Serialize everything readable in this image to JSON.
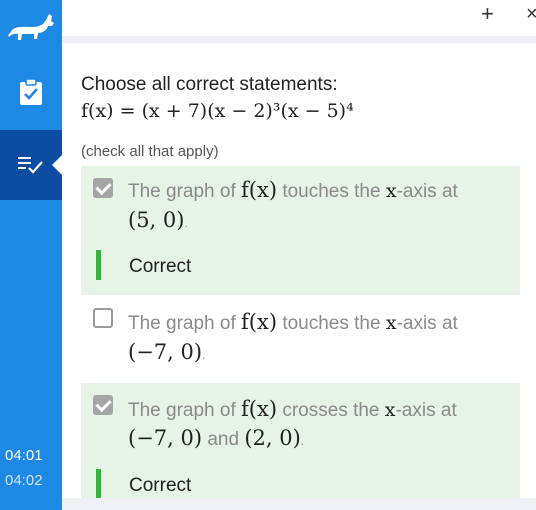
{
  "sidebar": {
    "logo_icon": "dog-logo-icon",
    "task_icon": "clipboard-check-icon",
    "list_icon": "list-check-icon",
    "timestamps": [
      "04:01",
      "04:02"
    ]
  },
  "topbar": {
    "plus_label": "+",
    "close_label": "×"
  },
  "question": {
    "prompt": "Choose all correct statements:",
    "function": "f(x) = (x + 7)(x − 2)³(x − 5)⁴",
    "hint": "(check all that apply)"
  },
  "choices": [
    {
      "checked": true,
      "text_a": "The graph of ",
      "fx": "f(x)",
      "text_b": " touches the ",
      "xvar": "x",
      "text_c": "-axis at",
      "point1": "(5, 0)",
      "dot": ".",
      "feedback": "Correct"
    },
    {
      "checked": false,
      "text_a": "The graph of ",
      "fx": "f(x)",
      "text_b": " touches the ",
      "xvar": "x",
      "text_c": "-axis at",
      "point1": "(−7, 0)",
      "dot": "."
    },
    {
      "checked": true,
      "text_a": "The graph of ",
      "fx": "f(x)",
      "text_b": " crosses the ",
      "xvar": "x",
      "text_c": "-axis at",
      "point1": "(−7, 0)",
      "and": " and ",
      "point2": "(2, 0)",
      "dot": ".",
      "feedback": "Correct"
    }
  ],
  "colors": {
    "sidebar": "#1e88e5",
    "sidebar_active": "#0d4ca3",
    "correct_bg": "#e6f3e6",
    "correct_bar": "#3cb043"
  }
}
